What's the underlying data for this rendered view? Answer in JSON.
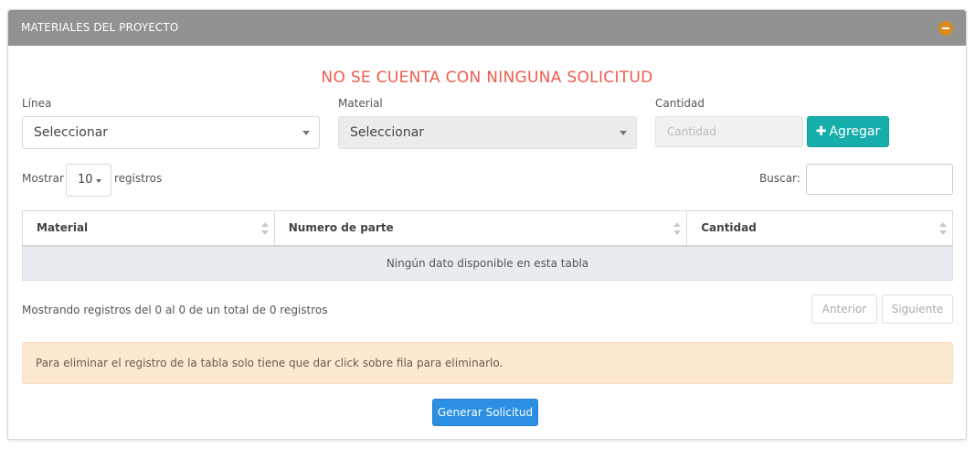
{
  "panel": {
    "title": "MATERIALES DEL PROYECTO",
    "collapse_icon": "minus-circle-icon",
    "header_color": "#929292"
  },
  "notice": {
    "text": "NO SE CUENTA CON NINGUNA SOLICITUD",
    "color": "#ef5b4e"
  },
  "form": {
    "linea_label": "Línea",
    "linea_value": "Seleccionar",
    "material_label": "Material",
    "material_value": "Seleccionar",
    "cantidad_label": "Cantidad",
    "cantidad_placeholder": "Cantidad",
    "add_button_label": "Agregar",
    "add_button_icon": "plus-icon",
    "add_button_color": "#15aeaa"
  },
  "table_controls": {
    "show_label": "Mostrar",
    "page_length": "10",
    "records_label": "registros",
    "search_label": "Buscar:"
  },
  "table": {
    "columns": [
      "Material",
      "Numero de parte",
      "Cantidad"
    ],
    "empty_message": "Ningún dato disponible en esta tabla"
  },
  "pagination": {
    "info": "Mostrando registros del 0 al 0 de un total de 0 registros",
    "previous": "Anterior",
    "next": "Siguiente"
  },
  "alert": {
    "text": "Para eliminar el registro de la tabla solo tiene que dar click sobre fila para eliminarlo.",
    "color": "#fde9d2"
  },
  "submit": {
    "label": "Generar Solicitud",
    "color": "#2b8fe3"
  }
}
